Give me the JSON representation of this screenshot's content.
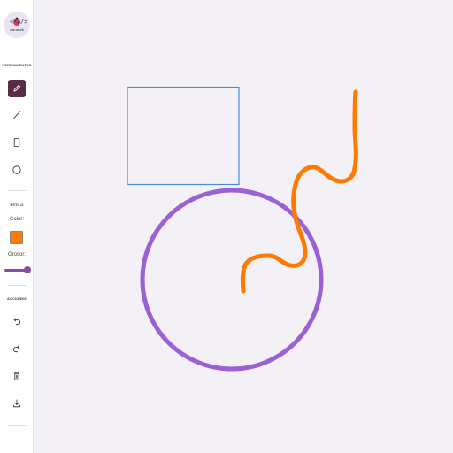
{
  "app": {
    "logo_text": "maicaspelli"
  },
  "sidebar": {
    "tools_title": "HERRAMIENTAS",
    "tools": [
      {
        "name": "pencil",
        "icon": "pencil-icon",
        "active": true
      },
      {
        "name": "line",
        "icon": "line-icon",
        "active": false
      },
      {
        "name": "rectangle",
        "icon": "rectangle-icon",
        "active": false
      },
      {
        "name": "circle",
        "icon": "circle-icon",
        "active": false
      }
    ],
    "style_title": "ESTILO",
    "color_label": "Color:",
    "color_value": "#ff7a00",
    "thickness_label": "Grosor:",
    "thickness_level": 1.0,
    "actions_title": "ACCIONES",
    "actions": [
      {
        "name": "undo",
        "icon": "undo-icon"
      },
      {
        "name": "redo",
        "icon": "redo-icon"
      },
      {
        "name": "clear",
        "icon": "trash-icon"
      },
      {
        "name": "download",
        "icon": "download-icon"
      }
    ]
  },
  "canvas": {
    "background": "#f3f1f6",
    "shapes": [
      {
        "type": "rectangle",
        "stroke": "#4a90d9"
      },
      {
        "type": "circle",
        "stroke": "#9b5fd6"
      },
      {
        "type": "freehand",
        "stroke": "#ff7a00"
      }
    ]
  },
  "colors": {
    "accent": "#5a2a46",
    "slider": "#8a4c9c"
  }
}
